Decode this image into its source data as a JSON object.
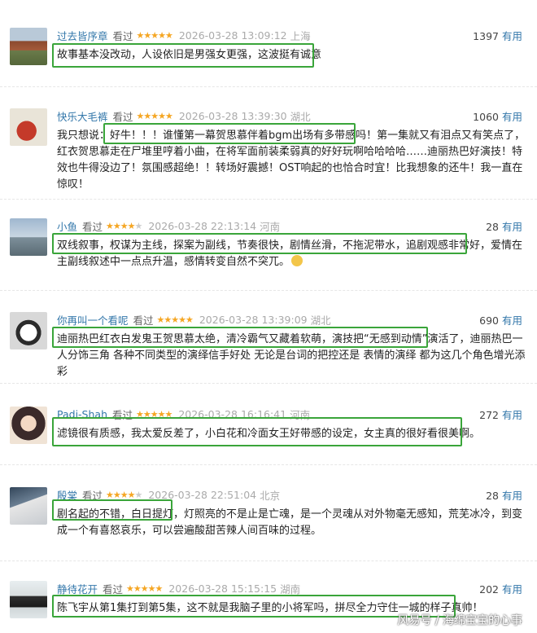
{
  "reviews": [
    {
      "user": "过去皆序章",
      "status": "看过",
      "rating": 5,
      "time": "2026-03-28 13:09:12",
      "location": "上海",
      "votes": "1397",
      "vote_label": "有用",
      "text": "故事基本没改动，人设依旧是男强女更强，这波挺有诚意"
    },
    {
      "user": "快乐大毛裤",
      "status": "看过",
      "rating": 5,
      "time": "2026-03-28 13:39:30",
      "location": "湖北",
      "votes": "1060",
      "vote_label": "有用",
      "text": "我只想说：好牛！！！谁懂第一幕贺思慕伴着bgm出场有多带感吗！第一集就又有泪点又有笑点了，红衣贺思慕走在尸堆里哼着小曲，在将军面前装柔弱真的好好玩啊哈哈哈哈……迪丽热巴好演技！特效也牛得没边了！氛围感超绝！！转场好震撼！OST响起的也恰合时宜！比我想象的还牛！我一直在惊叹！"
    },
    {
      "user": "小鱼",
      "status": "看过",
      "rating": 4,
      "time": "2026-03-28 22:13:14",
      "location": "河南",
      "votes": "28",
      "vote_label": "有用",
      "text": "双线叙事，权谋为主线，探案为副线，节奏很快，剧情丝滑，不拖泥带水，追剧观感非常好，爱情在主副线叙述中一点点升温，感情转变自然不突兀。"
    },
    {
      "user": "你再叫一个看呢",
      "status": "看过",
      "rating": 5,
      "time": "2026-03-28 13:39:09",
      "location": "湖北",
      "votes": "690",
      "vote_label": "有用",
      "text": "迪丽热巴红衣白发鬼王贺思慕太绝，清冷霸气又藏着软萌，演技把“无感到动情”演活了，迪丽热巴一人分饰三角 各种不同类型的演绎信手好处 无论是台词的把控还是 表情的演绎 都为这几个角色增光添彩"
    },
    {
      "user": "Padi-Shah",
      "status": "看过",
      "rating": 5,
      "time": "2026-03-28 16:16:41",
      "location": "河南",
      "votes": "272",
      "vote_label": "有用",
      "text": "滤镜很有质感，我太爱反差了，小白花和冷面女王好带感的设定，女主真的很好看很美啊。"
    },
    {
      "user": "殷棠",
      "status": "看过",
      "rating": 4,
      "time": "2026-03-28 22:51:04",
      "location": "北京",
      "votes": "28",
      "vote_label": "有用",
      "text": "剧名起的不错，白日提灯，灯照亮的不是止是亡魂，是一个灵魂从对外物毫无感知，荒芜冰冷，到变成一个有喜怒哀乐，可以尝遍酸甜苦辣人间百味的过程。"
    },
    {
      "user": "静待花开",
      "status": "看过",
      "rating": 5,
      "time": "2026-03-28 15:15:15",
      "location": "湖南",
      "votes": "202",
      "vote_label": "有用",
      "text": "陈飞宇从第1集打到第5集，这不就是我脑子里的小将军吗，拼尽全力守住一城的样子真帅！"
    }
  ],
  "watermark": "风易号 / 海绵宝宝的心事",
  "colors": {
    "username": "#3377aa",
    "stars": "#f5a623",
    "highlight": "#3aa53a",
    "meta": "#aaaaaa"
  }
}
